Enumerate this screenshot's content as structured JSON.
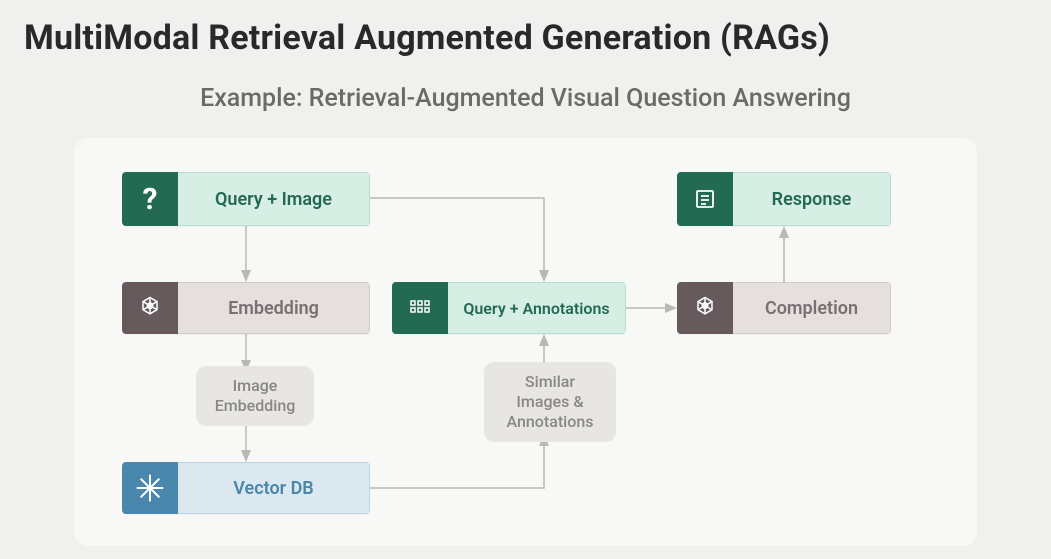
{
  "title": "MultiModal Retrieval Augmented Generation (RAGs)",
  "subtitle": "Example: Retrieval-Augmented Visual Question Answering",
  "nodes": {
    "query": {
      "label": "Query + Image",
      "icon": "question"
    },
    "embedding": {
      "label": "Embedding",
      "icon": "openai"
    },
    "vectordb": {
      "label": "Vector DB",
      "icon": "star"
    },
    "query_annot": {
      "label": "Query + Annotations",
      "icon": "grid"
    },
    "completion": {
      "label": "Completion",
      "icon": "openai"
    },
    "response": {
      "label": "Response",
      "icon": "doc"
    }
  },
  "annotations": {
    "image_embedding": "Image\nEmbedding",
    "similar": "Similar\nImages &\nAnnotations"
  }
}
